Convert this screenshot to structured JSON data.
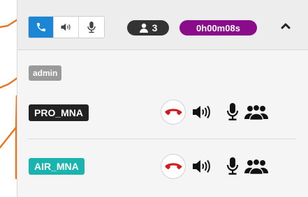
{
  "toolbar": {
    "buttons": [
      {
        "name": "phone",
        "icon": "phone-icon",
        "active": true
      },
      {
        "name": "speaker",
        "icon": "speaker-icon",
        "active": false
      },
      {
        "name": "microphone",
        "icon": "microphone-icon",
        "active": false
      }
    ],
    "participant_count": "3",
    "timer": "0h00m08s",
    "collapse_icon": "chevron-up-icon"
  },
  "users": {
    "admin": "admin",
    "participants": [
      {
        "label": "PRO_MNA",
        "color": "#222222"
      },
      {
        "label": "AIR_MNA",
        "color": "#19b4ad"
      }
    ]
  },
  "colors": {
    "accent": "#1c86d6",
    "timer": "#8a0c8a",
    "hangup": "#d01c1c",
    "annotation": "#e87722"
  }
}
